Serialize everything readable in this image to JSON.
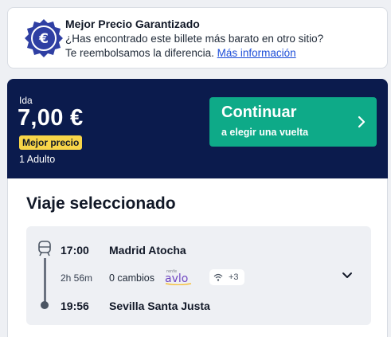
{
  "promo": {
    "title": "Mejor Precio Garantizado",
    "text": "¿Has encontrado este billete más barato en otro sitio? Te reembolsamos la diferencia.",
    "link": "Más información",
    "icon_symbol": "€",
    "icon_color": "#2f3fa3"
  },
  "summary": {
    "direction": "Ida",
    "price": "7,00 €",
    "best_badge": "Mejor precio",
    "passengers": "1 Adulto",
    "bg_color": "#0b1b4d",
    "cta_main": "Continuar",
    "cta_sub": "a elegir una vuelta",
    "cta_color": "#0eaa88"
  },
  "trip": {
    "title": "Viaje seleccionado",
    "departure_time": "17:00",
    "departure_station": "Madrid Atocha",
    "duration": "2h 56m",
    "changes": "0 cambios",
    "brand_top": "renfe",
    "brand": "avlo",
    "amenities_more": "+3",
    "arrival_time": "19:56",
    "arrival_station": "Sevilla Santa Justa"
  }
}
